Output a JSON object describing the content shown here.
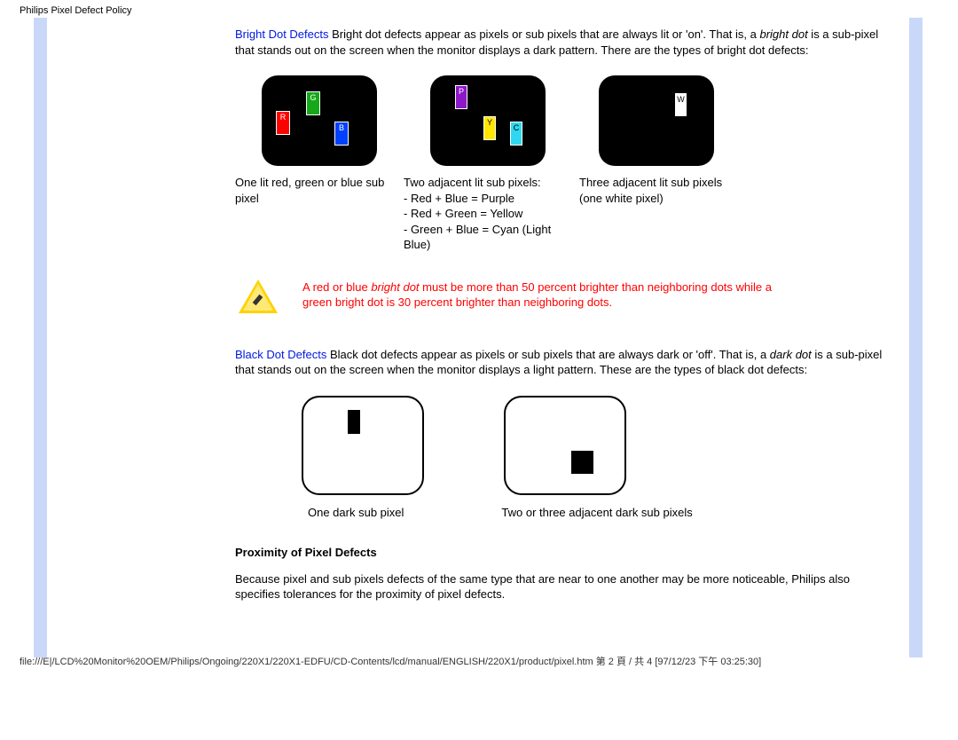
{
  "header": {
    "title": "Philips Pixel Defect Policy"
  },
  "bright": {
    "label": "Bright Dot Defects",
    "para_a": " Bright dot defects appear as pixels or sub pixels that are always lit or 'on'. That is, a ",
    "term": "bright dot",
    "para_b": " is a sub-pixel that stands out on the screen when the monitor displays a dark pattern. There are the types of bright dot defects:"
  },
  "subpx": {
    "R": "R",
    "G": "G",
    "B": "B",
    "P": "P",
    "Y": "Y",
    "C": "C",
    "W": "W"
  },
  "cap": {
    "c1": "One lit red, green or blue sub pixel",
    "c2_head": "Two adjacent lit sub pixels:",
    "c2_l1": "- Red + Blue = Purple",
    "c2_l2": "- Red + Green = Yellow",
    "c2_l3": "- Green + Blue = Cyan (Light Blue)",
    "c3_l1": "Three adjacent lit sub pixels",
    "c3_l2": "(one white pixel)"
  },
  "warning": {
    "l1_a": "A red or blue ",
    "l1_term": "bright dot",
    "l1_b": " must be more than 50 percent brighter than neighboring dots while a green bright dot is 30 percent brighter than neighboring dots."
  },
  "dark": {
    "label": "Black Dot Defects",
    "para_a": " Black dot defects appear as pixels or sub pixels that are always dark or 'off'. That is, a ",
    "term": "dark dot",
    "para_b": " is a sub-pixel that stands out on the screen when the monitor displays a light pattern. These are the types of black dot defects:"
  },
  "darkcap": {
    "c1": "One dark sub pixel",
    "c2": "Two or three adjacent dark sub pixels"
  },
  "proximity": {
    "heading": "Proximity of Pixel Defects",
    "para": "Because pixel and sub pixels defects of the same type that are near to one another may be more noticeable, Philips also specifies tolerances for the proximity of pixel defects."
  },
  "footer": {
    "path": "file:///E|/LCD%20Monitor%20OEM/Philips/Ongoing/220X1/220X1-EDFU/CD-Contents/lcd/manual/ENGLISH/220X1/product/pixel.htm 第 2 頁 / 共 4 [97/12/23 下午 03:25:30]"
  }
}
